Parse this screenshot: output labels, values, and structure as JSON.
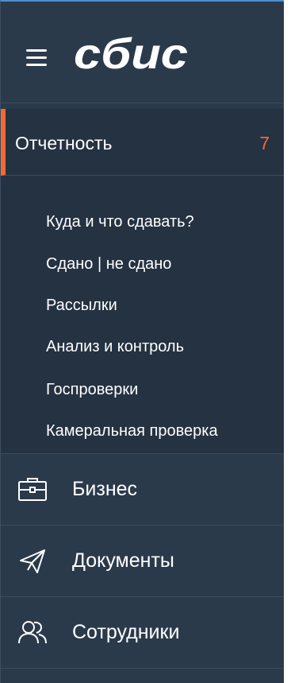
{
  "app": {
    "logo_text": "сбис"
  },
  "sidebar": {
    "active_item": {
      "label": "Отчетность",
      "count": "7"
    },
    "sub_items": [
      {
        "label": "Куда и что сдавать?"
      },
      {
        "label": "Сдано | не сдано"
      },
      {
        "label": "Рассылки"
      },
      {
        "label": "Анализ и контроль"
      },
      {
        "label": "Госпроверки"
      },
      {
        "label": "Камеральная проверка"
      }
    ],
    "sections": [
      {
        "label": "Бизнес",
        "icon": "briefcase-icon"
      },
      {
        "label": "Документы",
        "icon": "paper-plane-icon"
      },
      {
        "label": "Сотрудники",
        "icon": "people-icon"
      }
    ]
  },
  "colors": {
    "background": "#2b3a4b",
    "active_background": "#243242",
    "accent": "#f26a33",
    "text": "#ffffff",
    "top_border": "#4a8fd0"
  }
}
